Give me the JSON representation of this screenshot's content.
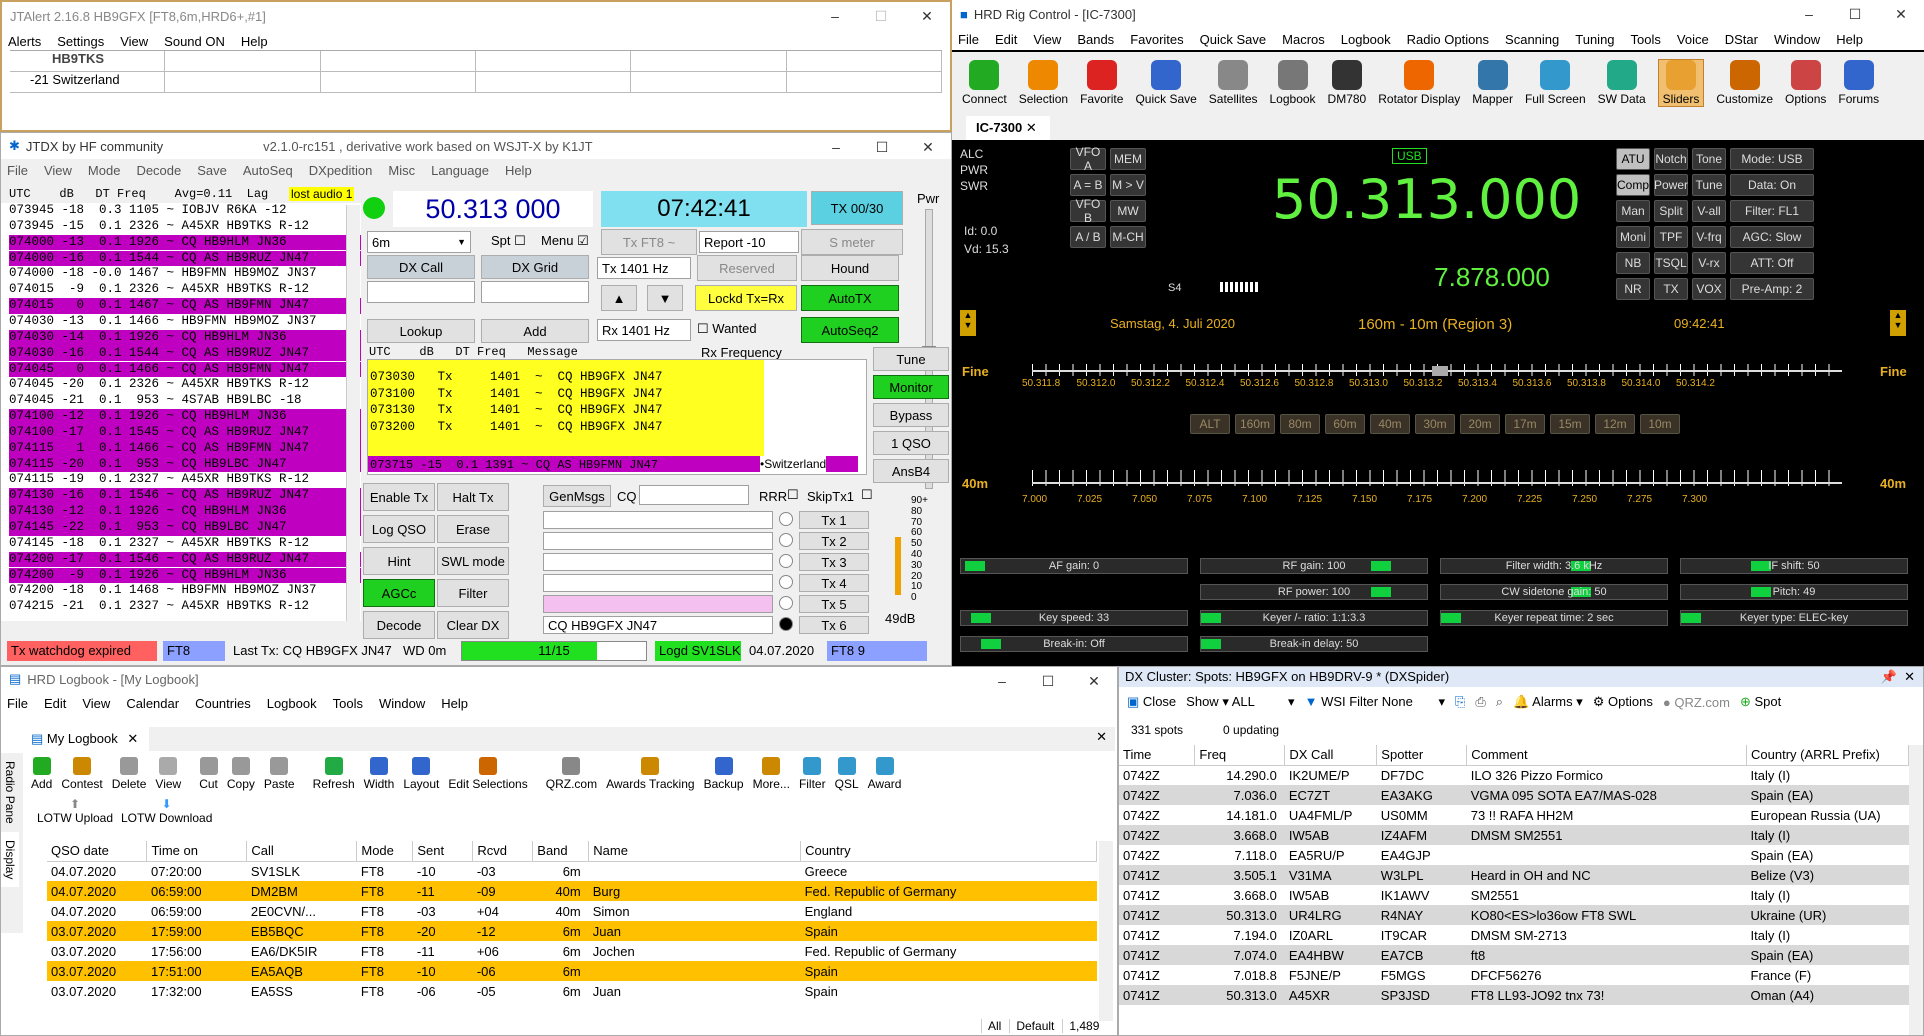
{
  "jtalert": {
    "title": "JTAlert 2.16.8 HB9GFX [FT8,6m,HRD6+,#1]",
    "menu": [
      "Alerts",
      "Settings",
      "View",
      "Sound ON",
      "Help"
    ],
    "callsign": "HB9TKS",
    "info": "-21 Switzerland"
  },
  "jtdx": {
    "title": "JTDX  by HF community",
    "version": "v2.1.0-rc151 , derivative work based on WSJT-X by K1JT",
    "menu": [
      "File",
      "View",
      "Mode",
      "Decode",
      "Save",
      "AutoSeq",
      "DXpedition",
      "Misc",
      "Language",
      "Help"
    ],
    "header": "UTC    dB   DT Freq    Avg=0.11  Lag",
    "lost_audio": "lost audio 1",
    "band_lines": [
      {
        "t": "073945 -18  0.3 1105 ~ IOBJV R6KA -12",
        "c": "wht"
      },
      {
        "t": "073945 -15  0.1 2326 ~ A45XR HB9TKS R-12",
        "c": "wht"
      },
      {
        "t": "074000 -13  0.1 1926 ~ CQ HB9HLM JN36",
        "c": "mag"
      },
      {
        "t": "074000 -16  0.1 1544 ~ CQ AS HB9RUZ JN47",
        "c": "mag"
      },
      {
        "t": "074000 -18 -0.0 1467 ~ HB9FMN HB9MOZ JN37",
        "c": "wht"
      },
      {
        "t": "074015  -9  0.1 2326 ~ A45XR HB9TKS R-12",
        "c": "wht"
      },
      {
        "t": "074015   0  0.1 1467 ~ CQ AS HB9FMN JN47",
        "c": "mag"
      },
      {
        "t": "074030 -13  0.1 1466 ~ HB9FMN HB9MOZ JN37",
        "c": "wht"
      },
      {
        "t": "074030 -14  0.1 1926 ~ CQ HB9HLM JN36",
        "c": "mag"
      },
      {
        "t": "074030 -16  0.1 1544 ~ CQ AS HB9RUZ JN47",
        "c": "mag"
      },
      {
        "t": "074045   0  0.1 1466 ~ CQ AS HB9FMN JN47",
        "c": "mag"
      },
      {
        "t": "074045 -20  0.1 2326 ~ A45XR HB9TKS R-12",
        "c": "wht"
      },
      {
        "t": "074045 -21  0.1  953 ~ 4S7AB HB9LBC -18",
        "c": "wht"
      },
      {
        "t": "074100 -12  0.1 1926 ~ CQ HB9HLM JN36",
        "c": "mag"
      },
      {
        "t": "074100 -17  0.1 1545 ~ CQ AS HB9RUZ JN47",
        "c": "mag"
      },
      {
        "t": "074115   1  0.1 1466 ~ CQ AS HB9FMN JN47",
        "c": "mag"
      },
      {
        "t": "074115 -20  0.1  953 ~ CQ HB9LBC JN47",
        "c": "mag"
      },
      {
        "t": "074115 -19  0.1 2327 ~ A45XR HB9TKS R-12",
        "c": "wht"
      },
      {
        "t": "074130 -16  0.1 1546 ~ CQ AS HB9RUZ JN47",
        "c": "mag"
      },
      {
        "t": "074130 -12  0.1 1926 ~ CQ HB9HLM JN36",
        "c": "mag"
      },
      {
        "t": "074145 -22  0.1  953 ~ CQ HB9LBC JN47",
        "c": "mag"
      },
      {
        "t": "074145 -18  0.1 2327 ~ A45XR HB9TKS R-12",
        "c": "wht"
      },
      {
        "t": "074200 -17  0.1 1546 ~ CQ AS HB9RUZ JN47",
        "c": "mag"
      },
      {
        "t": "074200  -9  0.1 1926 ~ CQ HB9HLM JN36",
        "c": "mag"
      },
      {
        "t": "074200 -18  0.1 1468 ~ HB9FMN HB9MOZ JN37",
        "c": "wht"
      },
      {
        "t": "074215 -21  0.1 2327 ~ A45XR HB9TKS R-12",
        "c": "wht"
      }
    ],
    "freq": "50.313 000",
    "time": "07:42:41",
    "tx_count": "TX 00/30",
    "pwr": "Pwr",
    "band": "6m",
    "spt": "Spt",
    "menu_chk": "Menu",
    "txmode": "Tx FT8 ~",
    "report": "Report -10",
    "smeter": "S meter",
    "dxcall": "DX Call",
    "dxgrid": "DX Grid",
    "txhz": "Tx  1401  Hz",
    "reserved": "Reserved",
    "hound": "Hound",
    "lockd": "Lockd Tx=Rx",
    "autotx": "AutoTX",
    "rxhz": "Rx  1401  Hz",
    "wanted": "Wanted",
    "autoseq2": "AutoSeq2",
    "lookup": "Lookup",
    "add": "Add",
    "rx_header": "UTC    dB   DT Freq   Message",
    "rxfreq_label": "Rx Frequency",
    "rx_lines": [
      "073030   Tx     1401  ~  CQ HB9GFX JN47",
      "073100   Tx     1401  ~  CQ HB9GFX JN47",
      "073130   Tx     1401  ~  CQ HB9GFX JN47",
      "073200   Tx     1401  ~  CQ HB9GFX JN47"
    ],
    "rx_last": "073715 -15  0.1 1391 ~ CQ AS HB9FMN JN47",
    "rx_country": "•Switzerland",
    "tune": "Tune",
    "monitor": "Monitor",
    "bypass": "Bypass",
    "one_qso": "1 QSO",
    "ansb4": "AnsB4",
    "enable_tx": "Enable Tx",
    "halt_tx": "Halt Tx",
    "log_qso": "Log QSO",
    "erase": "Erase",
    "hint": "Hint",
    "swl": "SWL mode",
    "agcc": "AGCc",
    "filter": "Filter",
    "decode": "Decode",
    "clear_dx": "Clear DX",
    "genmsgs": "GenMsgs",
    "cq": "CQ",
    "rrr": "RRR",
    "skiptx1": "SkipTx1",
    "tx_buttons": [
      "Tx 1",
      "Tx 2",
      "Tx 3",
      "Tx 4",
      "Tx 5",
      "Tx 6"
    ],
    "tx6_msg": "CQ HB9GFX JN47",
    "db_level": "49dB",
    "scale": [
      "90+",
      "80",
      "70",
      "60",
      "50",
      "40",
      "30",
      "20",
      "10",
      "0"
    ],
    "status": {
      "watchdog": "Tx watchdog expired",
      "mode": "FT8",
      "last_tx": "Last Tx: CQ HB9GFX JN47",
      "wd": "WD 0m",
      "progress": "11/15",
      "logd": "Logd SV1SLK",
      "date": "04.07.2020",
      "ft8n": "FT8  9"
    }
  },
  "rig": {
    "title": "HRD Rig Control - [IC-7300]",
    "menu": [
      "File",
      "Edit",
      "View",
      "Bands",
      "Favorites",
      "Quick Save",
      "Macros",
      "Logbook",
      "Radio Options",
      "Scanning",
      "Tuning",
      "Tools",
      "Voice",
      "DStar",
      "Window",
      "Help"
    ],
    "toolbar": [
      "Connect",
      "Selection",
      "Favorite",
      "Quick Save",
      "Satellites",
      "Logbook",
      "DM780",
      "Rotator Display",
      "Mapper",
      "Full Screen",
      "SW Data",
      "Sliders",
      "Customize",
      "Options",
      "Forums"
    ],
    "tab": "IC-7300",
    "meters": [
      "ALC",
      "PWR",
      "SWR"
    ],
    "id": "Id: 0.0",
    "vd": "Vd: 15.3",
    "vfo": [
      "VFO A",
      "MEM",
      "A = B",
      "M > V",
      "VFO B",
      "MW",
      "A / B",
      "M-CH"
    ],
    "mode": "USB",
    "freq": "50.313.000",
    "sub_freq": "7.878.000",
    "s_label": "S4",
    "right_buttons": [
      [
        "ATU",
        "Notch",
        "Tone",
        "Mode: USB"
      ],
      [
        "Comp",
        "Power",
        "Tune",
        "Data: On"
      ],
      [
        "Man",
        "Split",
        "V-all",
        "Filter: FL1"
      ],
      [
        "Moni",
        "TPF",
        "V-frq",
        "AGC: Slow"
      ],
      [
        "NB",
        "TSQL",
        "V-rx",
        "ATT: Off"
      ],
      [
        "NR",
        "TX",
        "VOX",
        "Pre-Amp: 2"
      ]
    ],
    "date": "Samstag, 4. Juli 2020",
    "region": "160m - 10m (Region 3)",
    "clock": "09:42:41",
    "fine": "Fine",
    "scale1": [
      "50.311.8",
      "50.312.0",
      "50.312.2",
      "50.312.4",
      "50.312.6",
      "50.312.8",
      "50.313.0",
      "50.313.2",
      "50.313.4",
      "50.313.6",
      "50.313.8",
      "50.314.0",
      "50.314.2"
    ],
    "bands": [
      "ALT",
      "160m",
      "80m",
      "60m",
      "40m",
      "30m",
      "20m",
      "17m",
      "15m",
      "12m",
      "10m"
    ],
    "band40": "40m",
    "scale2": [
      "7.000",
      "7.025",
      "7.050",
      "7.075",
      "7.100",
      "7.125",
      "7.150",
      "7.175",
      "7.200",
      "7.225",
      "7.250",
      "7.275",
      "7.300"
    ],
    "sliders": [
      [
        "AF gain: 0",
        "RF gain: 100",
        "Filter width: 3.6 kHz",
        "IF shift: 50"
      ],
      [
        "",
        "RF power: 100",
        "CW sidetone gain: 50",
        "Pitch: 49"
      ],
      [
        "Key speed: 33",
        "Keyer /- ratio: 1:1:3.3",
        "Keyer repeat time: 2 sec",
        "Keyer type: ELEC-key"
      ],
      [
        "Break-in: Off",
        "Break-in delay: 50",
        "",
        ""
      ]
    ]
  },
  "logbook": {
    "title": "HRD Logbook - [My Logbook]",
    "menu": [
      "File",
      "Edit",
      "View",
      "Calendar",
      "Countries",
      "Logbook",
      "Tools",
      "Window",
      "Help"
    ],
    "tab": "My Logbook",
    "toolbar": [
      "Add",
      "Contest",
      "Delete",
      "View",
      "Cut",
      "Copy",
      "Paste",
      "Refresh",
      "Width",
      "Layout",
      "Edit Selections",
      "QRZ.com",
      "Awards Tracking",
      "Backup",
      "More...",
      "Filter",
      "QSL",
      "Award"
    ],
    "lotw_up": "LOTW Upload",
    "lotw_down": "LOTW Download",
    "side1": "Radio Pane",
    "side2": "Display",
    "columns": [
      "QSO date",
      "Time on",
      "Call",
      "Mode",
      "Sent",
      "Rcvd",
      "Band",
      "Name",
      "Country"
    ],
    "rows": [
      [
        "04.07.2020",
        "07:20:00",
        "SV1SLK",
        "FT8",
        "-10",
        "-03",
        "6m",
        "",
        "Greece",
        0
      ],
      [
        "04.07.2020",
        "06:59:00",
        "DM2BM",
        "FT8",
        "-11",
        "-09",
        "40m",
        "Burg",
        "Fed. Republic of Germany",
        1
      ],
      [
        "04.07.2020",
        "06:59:00",
        "2E0CVN/...",
        "FT8",
        "-03",
        "+04",
        "40m",
        "Simon",
        "England",
        0
      ],
      [
        "03.07.2020",
        "17:59:00",
        "EB5BQC",
        "FT8",
        "-20",
        "-12",
        "6m",
        "Juan",
        "Spain",
        1
      ],
      [
        "03.07.2020",
        "17:56:00",
        "EA6/DK5IR",
        "FT8",
        "-11",
        "+06",
        "6m",
        "Jochen",
        "Fed. Republic of Germany",
        0
      ],
      [
        "03.07.2020",
        "17:51:00",
        "EA5AQB",
        "FT8",
        "-10",
        "-06",
        "6m",
        "",
        "Spain",
        1
      ],
      [
        "03.07.2020",
        "17:32:00",
        "EA5SS",
        "FT8",
        "-06",
        "-05",
        "6m",
        "Juan",
        "Spain",
        0
      ]
    ],
    "footer": [
      "All",
      "Default",
      "1,489"
    ]
  },
  "dx": {
    "title": "DX Cluster: Spots: HB9GFX on HB9DRV-9 * (DXSpider)",
    "close": "Close",
    "show": "Show",
    "all": "ALL",
    "wsi": "WSI Filter",
    "none": "None",
    "alarms": "Alarms",
    "options": "Options",
    "qrz": "QRZ.com",
    "spot": "Spot",
    "spots": "331 spots",
    "updating": "0 updating",
    "columns": [
      "Time",
      "Freq",
      "DX Call",
      "Spotter",
      "Comment",
      "Country (ARRL Prefix)"
    ],
    "rows": [
      [
        "0742Z",
        "14.290.0",
        "IK2UME/P",
        "DF7DC",
        "ILO 326 Pizzo Formico",
        "Italy (I)"
      ],
      [
        "0742Z",
        "7.036.0",
        "EC7ZT",
        "EA3AKG",
        "VGMA 095 SOTA EA7/MAS-028",
        "Spain (EA)"
      ],
      [
        "0742Z",
        "14.181.0",
        "UA4FML/P",
        "US0MM",
        "73 !! RAFA HH2M",
        "European Russia (UA)"
      ],
      [
        "0742Z",
        "3.668.0",
        "IW5AB",
        "IZ4AFM",
        "DMSM SM2551",
        "Italy (I)"
      ],
      [
        "0742Z",
        "7.118.0",
        "EA5RU/P",
        "EA4GJP",
        "",
        "Spain (EA)"
      ],
      [
        "0741Z",
        "3.505.1",
        "V31MA",
        "W3LPL",
        "Heard in OH and NC",
        "Belize (V3)"
      ],
      [
        "0741Z",
        "3.668.0",
        "IW5AB",
        "IK1AWV",
        "SM2551",
        "Italy (I)"
      ],
      [
        "0741Z",
        "50.313.0",
        "UR4LRG",
        "R4NAY",
        "KO80<ES>lo36ow FT8 SWL",
        "Ukraine (UR)"
      ],
      [
        "0741Z",
        "7.194.0",
        "IZ0ARL",
        "IT9CAR",
        "DMSM SM-2713",
        "Italy (I)"
      ],
      [
        "0741Z",
        "7.074.0",
        "EA4HBW",
        "EA7CB",
        "ft8",
        "Spain (EA)"
      ],
      [
        "0741Z",
        "7.018.8",
        "F5JNE/P",
        "F5MGS",
        "DFCF56276",
        "France (F)"
      ],
      [
        "0741Z",
        "50.313.0",
        "A45XR",
        "SP3JSD",
        "FT8  LL93-JO92 tnx 73!",
        "Oman (A4)"
      ]
    ]
  }
}
